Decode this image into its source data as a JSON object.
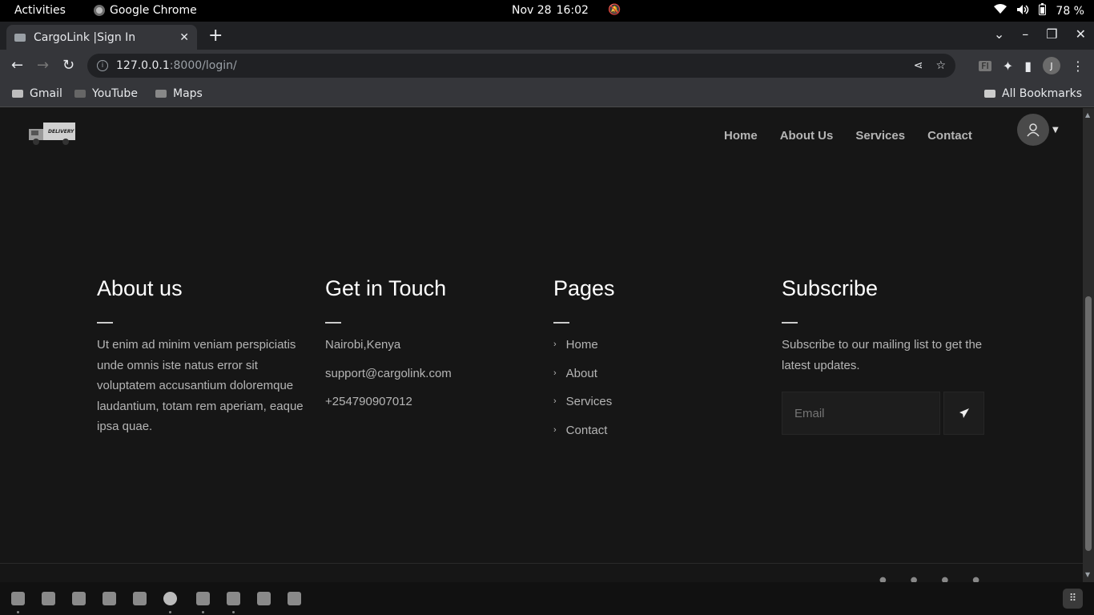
{
  "system": {
    "activities": "Activities",
    "app_name": "Google Chrome",
    "date": "Nov 28",
    "time": "16:02",
    "battery": "78 %"
  },
  "browser": {
    "tab_title": "CargoLink |Sign In",
    "url_host": "127.0.0.1",
    "url_path": ":8000/login/",
    "profile_initial": "J",
    "bookmarks": [
      "Gmail",
      "YouTube",
      "Maps"
    ],
    "all_bookmarks": "All Bookmarks"
  },
  "site": {
    "logo_text": "DELIVERY",
    "nav": [
      "Home",
      "About Us",
      "Services",
      "Contact"
    ]
  },
  "footer": {
    "about": {
      "heading": "About us",
      "text": "Ut enim ad minim veniam perspiciatis unde omnis iste natus error sit voluptatem accusantium doloremque laudantium, totam rem aperiam, eaque ipsa quae."
    },
    "contact": {
      "heading": "Get in Touch",
      "location": "Nairobi,Kenya",
      "email": "support@cargolink.com",
      "phone": "+254790907012"
    },
    "pages": {
      "heading": "Pages",
      "links": [
        "Home",
        "About",
        "Services",
        "Contact"
      ]
    },
    "subscribe": {
      "heading": "Subscribe",
      "text": "Subscribe to our mailing list to get the latest updates.",
      "email_placeholder": "Email"
    }
  }
}
